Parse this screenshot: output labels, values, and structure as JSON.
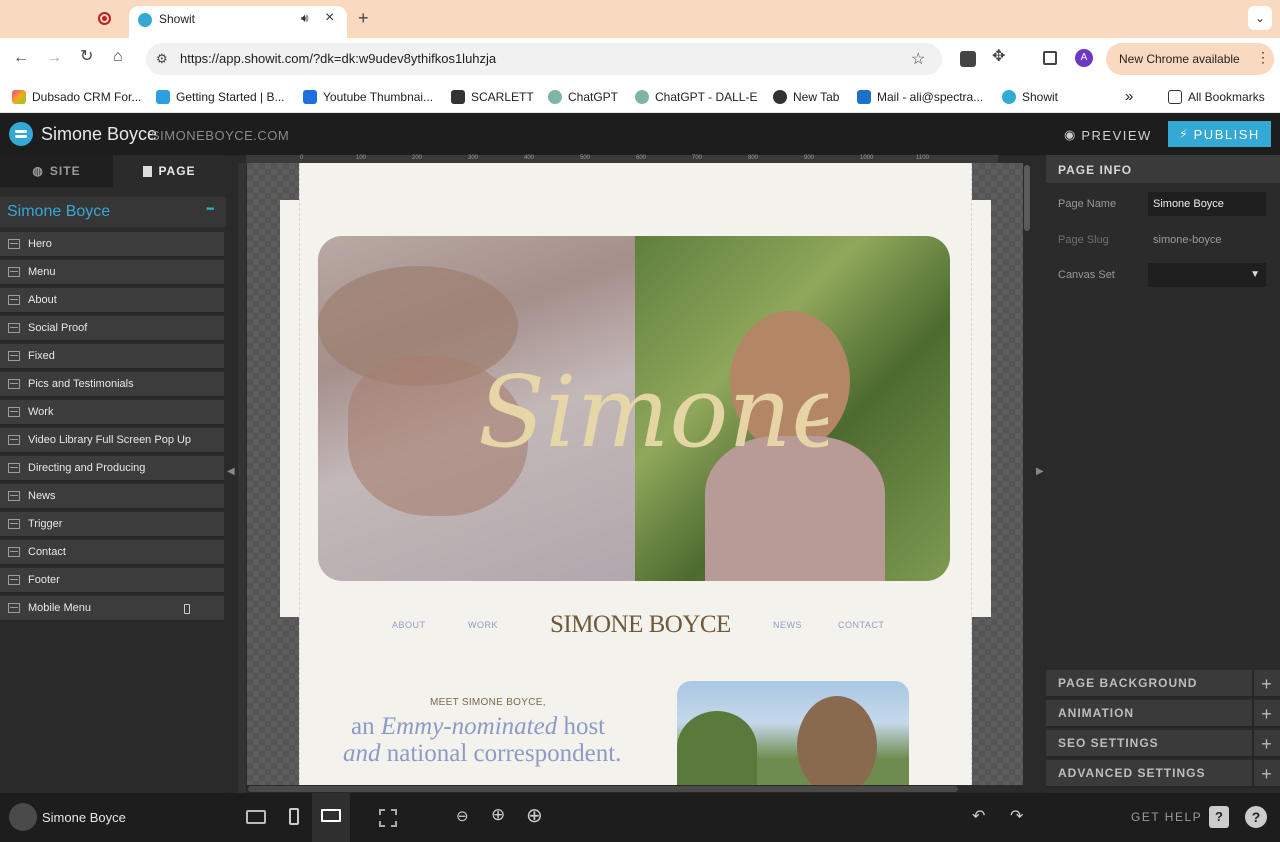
{
  "browser": {
    "tabs": [
      {
        "title": "",
        "icon": "record-icon"
      },
      {
        "title": "Showit",
        "icon": "showit-icon",
        "active": true
      }
    ],
    "url": "https://app.showit.com/?dk=dk:w9udev8ythifkos1luhzja",
    "new_chrome": "New Chrome available",
    "profile_initial": "A",
    "bookmarks": [
      "Dubsado CRM For...",
      "Getting Started | B...",
      "Youtube Thumbnai...",
      "SCARLETT",
      "ChatGPT",
      "ChatGPT - DALL-E",
      "New Tab",
      "Mail - ali@spectra...",
      "Showit"
    ],
    "all_bookmarks": "All Bookmarks",
    "more": "»"
  },
  "app": {
    "site_name": "Simone Boyce",
    "site_domain": "SIMONEBOYCE.COM",
    "preview": "PREVIEW",
    "publish": "PUBLISH",
    "accent": "#35a9d6"
  },
  "left_panel": {
    "tab_site": "SITE",
    "tab_page": "PAGE",
    "page_title": "Simone Boyce",
    "more": "•••",
    "canvases": [
      "Hero",
      "Menu",
      "About",
      "Social Proof",
      "Fixed",
      "Pics and Testimonials",
      "Work",
      "Video Library Full Screen Pop Up",
      "Directing and Producing",
      "News",
      "Trigger",
      "Contact",
      "Footer",
      "Mobile Menu"
    ]
  },
  "canvas": {
    "ruler_ticks": [
      "0",
      "100",
      "200",
      "300",
      "400",
      "500",
      "600",
      "700",
      "800",
      "900",
      "1000",
      "1100"
    ],
    "hero_script": "Simone",
    "nav": {
      "about": "ABOUT",
      "work": "WORK",
      "brand": "SIMONE BOYCE",
      "news": "NEWS",
      "contact": "CONTACT"
    },
    "meet": "MEET SIMONE BOYCE,",
    "tagline_1a": "an ",
    "tagline_1b": "Emmy-nominated",
    "tagline_1c": " host",
    "tagline_2a": "and",
    "tagline_2b": " national correspondent."
  },
  "right_panel": {
    "header": "PAGE INFO",
    "page_name_label": "Page Name",
    "page_name_value": "Simone Boyce",
    "page_slug_label": "Page Slug",
    "page_slug_value": "simone-boyce",
    "canvas_set_label": "Canvas Set",
    "sections": [
      "PAGE BACKGROUND",
      "ANIMATION",
      "SEO SETTINGS",
      "ADVANCED SETTINGS"
    ]
  },
  "bottom_bar": {
    "user_name": "Simone Boyce",
    "get_help": "GET HELP"
  }
}
